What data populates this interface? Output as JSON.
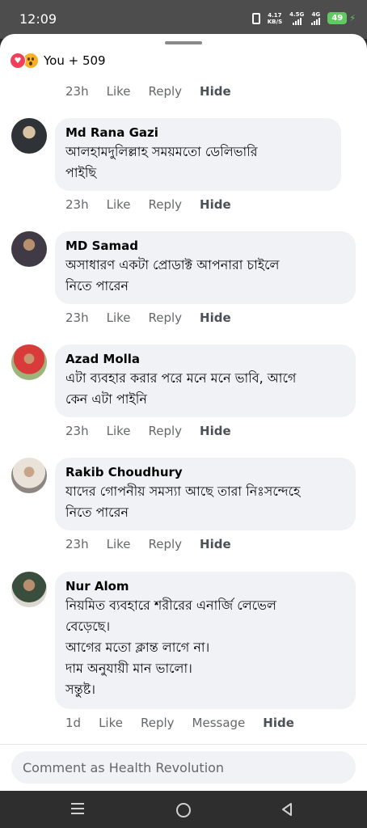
{
  "status_bar": {
    "time": "12:09",
    "net_speed_value": "4.17",
    "net_speed_unit": "KB/S",
    "signal1_label": "4.5G",
    "signal2_label": "4G",
    "battery": "49"
  },
  "reactions": {
    "summary": "You + 509",
    "icons": [
      "love-icon",
      "wow-icon"
    ]
  },
  "top_actions": {
    "time": "23h",
    "like": "Like",
    "reply": "Reply",
    "hide": "Hide"
  },
  "comments": [
    {
      "name": "Md Rana Gazi",
      "text": "আলহামদুলিল্লাহ সময়মতো ডেলিভারি\nপাইছি",
      "time": "23h",
      "like": "Like",
      "reply": "Reply",
      "hide": "Hide"
    },
    {
      "name": "MD Samad",
      "text": "অসাধারণ একটা প্রোডাক্ট আপনারা চাইলে\nনিতে পারেন",
      "time": "23h",
      "like": "Like",
      "reply": "Reply",
      "hide": "Hide"
    },
    {
      "name": "Azad Molla",
      "text": "এটা ব্যবহার করার পরে মনে  মনে ভাবি, আগে\nকেন এটা পাইনি",
      "time": "23h",
      "like": "Like",
      "reply": "Reply",
      "hide": "Hide"
    },
    {
      "name": "Rakib Choudhury",
      "text": "যাদের গোপনীয় সমস্যা আছে তারা নিঃসন্দেহে\nনিতে পারেন",
      "time": "23h",
      "like": "Like",
      "reply": "Reply",
      "hide": "Hide"
    },
    {
      "name": "Nur Alom",
      "text": "নিয়মিত ব্যবহারে শরীরের এনার্জি লেভেল\nবেড়েছে।\nআগের মতো ক্লান্ত লাগে না।\nদাম অনুযায়ী মান ভালো।\nসন্তুষ্ট।",
      "time": "1d",
      "like": "Like",
      "reply": "Reply",
      "message": "Message",
      "hide": "Hide"
    }
  ],
  "comment_input": {
    "placeholder": "Comment as Health Revolution"
  }
}
